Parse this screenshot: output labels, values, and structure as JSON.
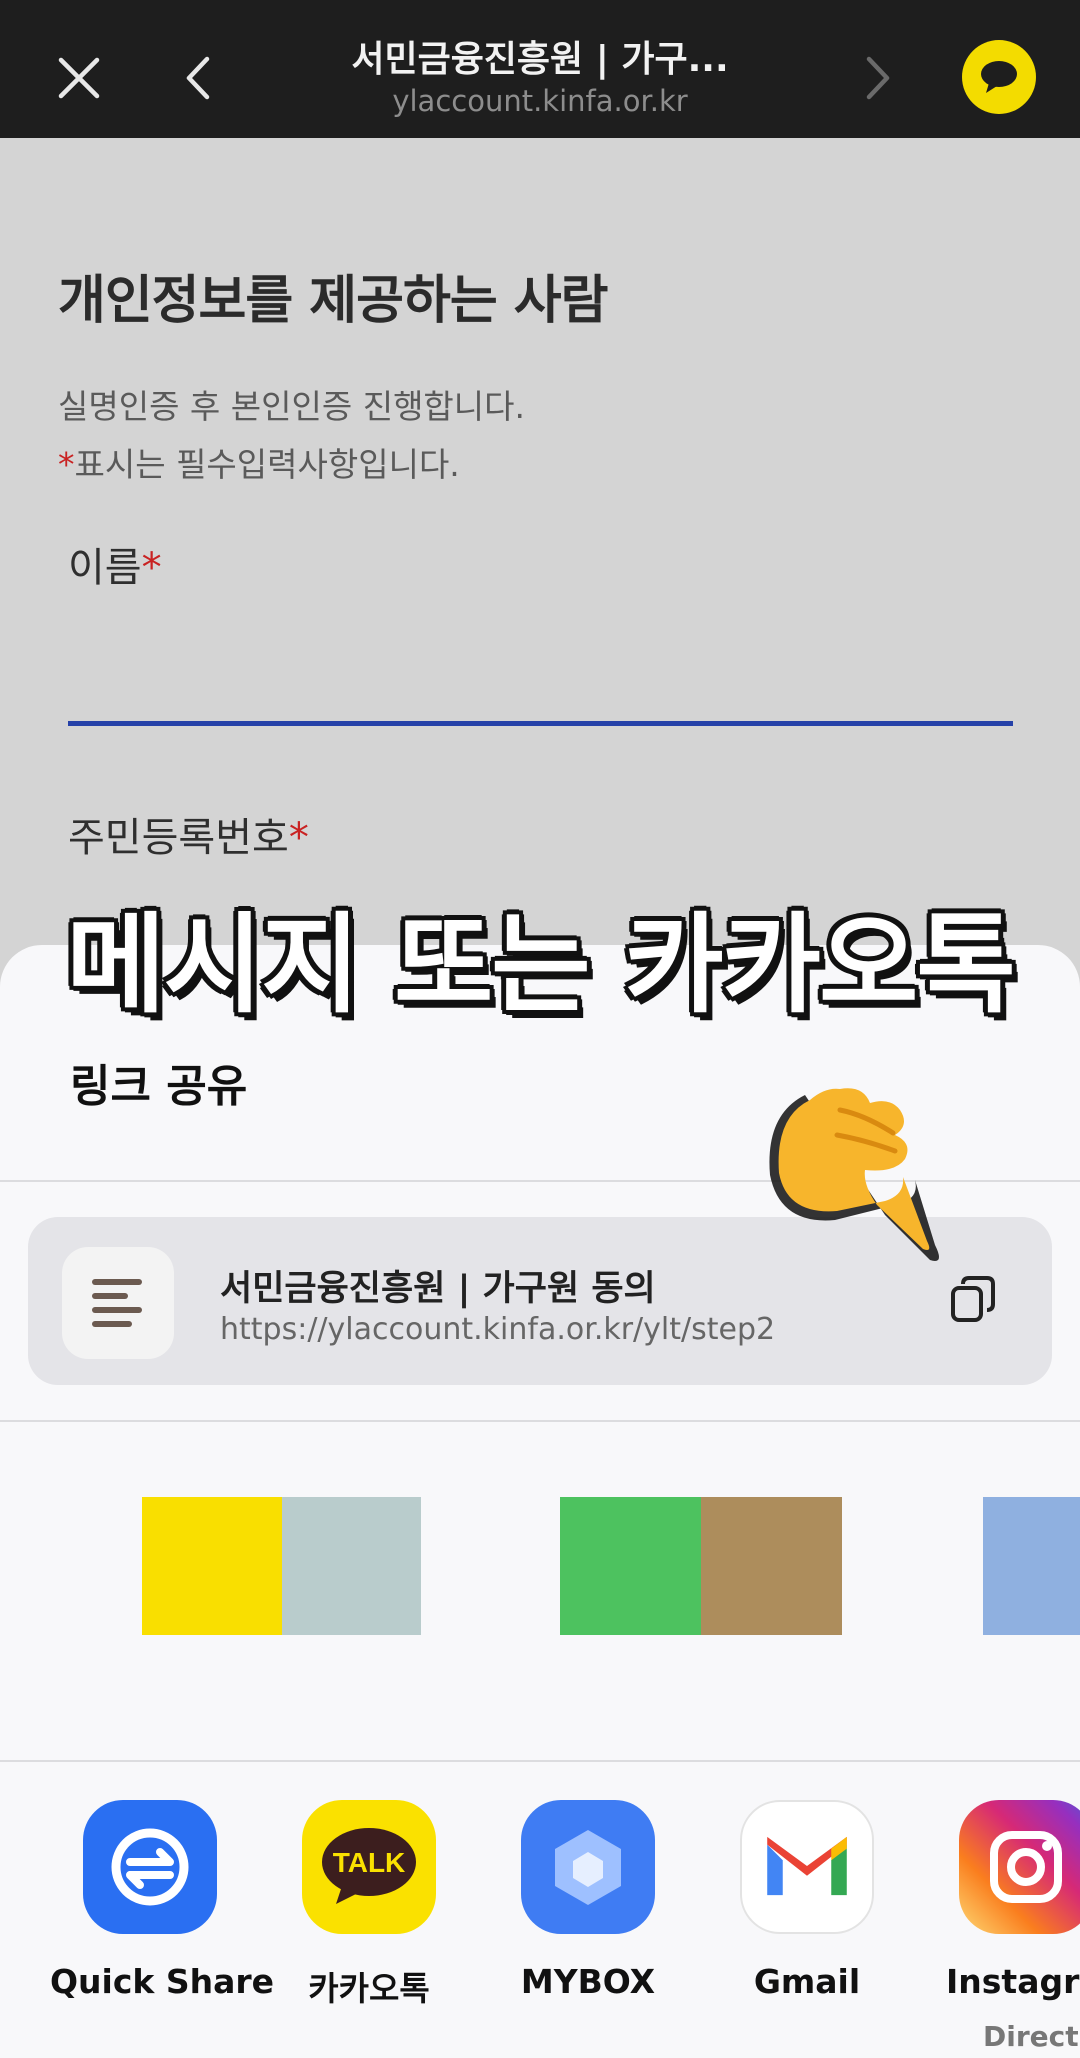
{
  "browser": {
    "title": "서민금융진흥원 | 가구...",
    "url": "ylaccount.kinfa.or.kr"
  },
  "form": {
    "heading": "개인정보를 제공하는 사람",
    "desc1": "실명인증 후 본인인증 진행합니다.",
    "desc2_mark": "*",
    "desc2": "표시는 필수입력사항입니다.",
    "name_label": "이름",
    "rrn_label": "주민등록번호",
    "required_mark": "*"
  },
  "caption": "메시지 또는 카카오톡",
  "share": {
    "title": "링크 공유",
    "link_title": "서민금융진흥원 | 가구원 동의",
    "link_url": "https://ylaccount.kinfa.or.kr/ylt/step2"
  },
  "thumbnail_colors": [
    "#f9df00",
    "#b9cccc",
    "#4dc25f",
    "#ad8d5c",
    "#8fb0e0"
  ],
  "apps": [
    {
      "label": "Quick Share",
      "icon": "quick-share-icon",
      "color": "#2a6ff2"
    },
    {
      "label": "카카오톡",
      "icon": "kakaotalk-icon",
      "color": "#fae100"
    },
    {
      "label": "MYBOX",
      "icon": "mybox-icon",
      "color": "#3f7cf3"
    },
    {
      "label": "Gmail",
      "icon": "gmail-icon",
      "color": "#ffffff"
    },
    {
      "label": "Instagra",
      "sub": "Direct",
      "icon": "instagram-icon",
      "color": "#e1306c"
    }
  ]
}
